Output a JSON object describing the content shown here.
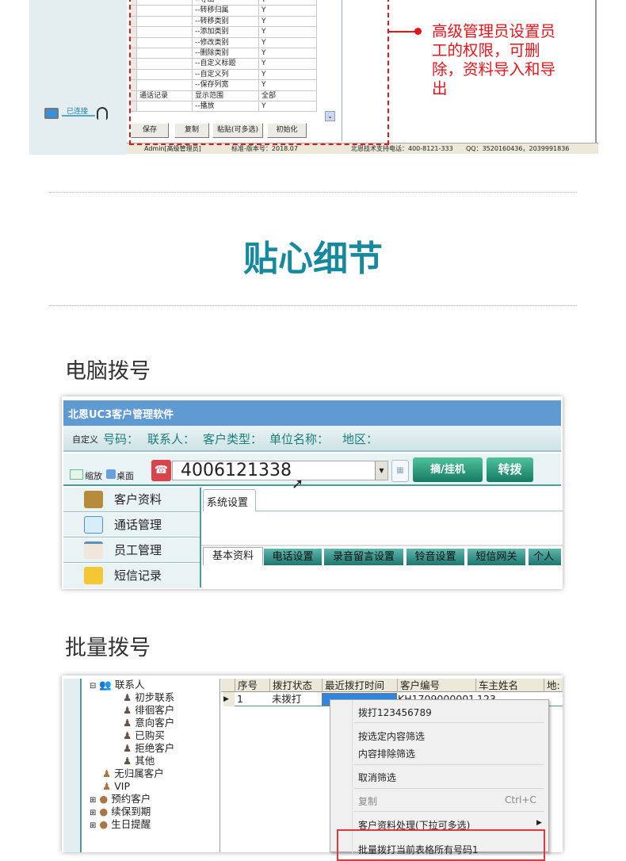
{
  "top_screenshot": {
    "connection_status": "已连接",
    "permission_rows": [
      {
        "c1": "",
        "c2": "--导出",
        "c3": "Y"
      },
      {
        "c1": "",
        "c2": "--转移归属",
        "c3": "Y"
      },
      {
        "c1": "",
        "c2": "--转移类别",
        "c3": "Y"
      },
      {
        "c1": "",
        "c2": "--添加类别",
        "c3": "Y"
      },
      {
        "c1": "",
        "c2": "--修改类别",
        "c3": "Y"
      },
      {
        "c1": "",
        "c2": "--删除类别",
        "c3": "Y"
      },
      {
        "c1": "",
        "c2": "--自定义标题",
        "c3": "Y"
      },
      {
        "c1": "",
        "c2": "--自定义列",
        "c3": "Y"
      },
      {
        "c1": "",
        "c2": "--保存列宽",
        "c3": "Y"
      },
      {
        "c1": "通话记录",
        "c2": "显示范围",
        "c3": "全部"
      },
      {
        "c1": "",
        "c2": "--播放",
        "c3": "Y"
      }
    ],
    "buttons": {
      "save": "保存",
      "copy": "复制",
      "paste": "粘贴(可多选)",
      "init": "初始化"
    },
    "status": {
      "user": "Admin[高级管理员]",
      "version": "标准-版本号：2018.07",
      "support": "北恩技术支持电话：400-8121-333",
      "qq": "QQ：3520160436，2039991836"
    },
    "annotation": "高级管理员设置员工的权限，可删除，资料导入和导出"
  },
  "section_title": "贴心细节",
  "pc_dial": {
    "heading": "电脑拨号",
    "app_title": "北恩UC3客户管理软件",
    "custom_label": "自定义",
    "search_fields": [
      "号码：",
      "联系人：",
      "客户类型：",
      "单位名称：",
      "地区："
    ],
    "zoom_label": "缩放",
    "desktop_label": "桌面",
    "phone_number": "4006121338",
    "dial_button": "摘/挂机",
    "transfer_button": "转拨",
    "nav": [
      "客户资料",
      "通话管理",
      "员工管理",
      "短信记录"
    ],
    "main_tab": "系统设置",
    "sub_tabs": [
      "基本资料",
      "电话设置",
      "录音留言设置",
      "铃音设置",
      "短信网关",
      "个人设"
    ]
  },
  "batch_dial": {
    "heading": "批量拨号",
    "tree_root": "联系人",
    "tree_children": [
      "初步联系",
      "徘徊客户",
      "意向客户",
      "已购买",
      "拒绝客户",
      "其他"
    ],
    "tree_other": [
      "无归属客户",
      "VIP",
      "预约客户",
      "续保到期",
      "生日提醒"
    ],
    "columns": [
      "序号",
      "拨打状态",
      "最近拨打时间",
      "客户编号",
      "车主姓名",
      "地:"
    ],
    "row": {
      "index": "1",
      "status": "未拨打",
      "time": "",
      "id": "KH1709000001",
      "name": "123"
    },
    "menu": {
      "dial": "拨打123456789",
      "filter_selected": "按选定内容筛选",
      "filter_exclude": "内容排除筛选",
      "cancel_filter": "取消筛选",
      "copy": "复制",
      "copy_shortcut": "Ctrl+C",
      "process": "客户资料处理(下拉可多选)",
      "batch": "批量拨打当前表格所有号码1"
    }
  },
  "colors": {
    "accent": "#16899f",
    "annotation": "#e8141b",
    "app_title_bar": "#5f9ad3",
    "button_green": "#1e8a74"
  }
}
